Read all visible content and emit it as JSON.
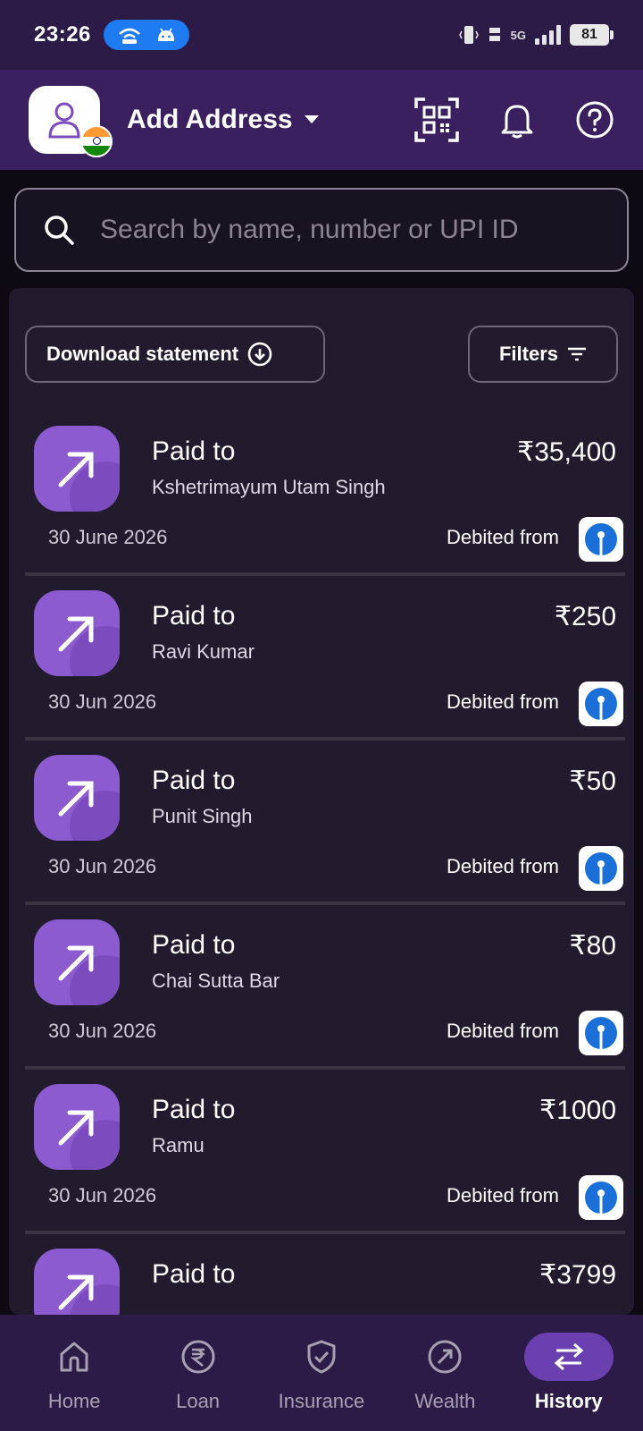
{
  "status_bar": {
    "time": "23:26",
    "network": "5G",
    "battery": "81"
  },
  "header": {
    "title": "Add Address"
  },
  "search": {
    "placeholder": "Search by name, number or UPI ID"
  },
  "actions": {
    "download_label": "Download statement",
    "filters_label": "Filters"
  },
  "transactions": [
    {
      "type": "Paid to",
      "party": "Kshetrimayum Utam Singh",
      "amount": "₹35,400",
      "date": "30 June 2026",
      "debited_label": "Debited from"
    },
    {
      "type": "Paid to",
      "party": "Ravi Kumar",
      "amount": "₹250",
      "date": "30 Jun 2026",
      "debited_label": "Debited from"
    },
    {
      "type": "Paid to",
      "party": "Punit Singh",
      "amount": "₹50",
      "date": "30 Jun 2026",
      "debited_label": "Debited from"
    },
    {
      "type": "Paid to",
      "party": "Chai Sutta Bar",
      "amount": "₹80",
      "date": "30 Jun 2026",
      "debited_label": "Debited from"
    },
    {
      "type": "Paid to",
      "party": "Ramu",
      "amount": "₹1000",
      "date": "30 Jun 2026",
      "debited_label": "Debited from"
    },
    {
      "type": "Paid to",
      "party": "",
      "amount": "₹3799",
      "date": "",
      "debited_label": ""
    }
  ],
  "nav": [
    {
      "label": "Home",
      "icon": "home-icon",
      "active": false
    },
    {
      "label": "Loan",
      "icon": "rupee-icon",
      "active": false
    },
    {
      "label": "Insurance",
      "icon": "shield-check-icon",
      "active": false
    },
    {
      "label": "Wealth",
      "icon": "arrow-circle-icon",
      "active": false
    },
    {
      "label": "History",
      "icon": "swap-arrows-icon",
      "active": true
    }
  ],
  "colors": {
    "header": "#3b2060",
    "accent": "#8c5bd0",
    "card": "#221b2d",
    "active_nav": "#6a3fb0"
  }
}
